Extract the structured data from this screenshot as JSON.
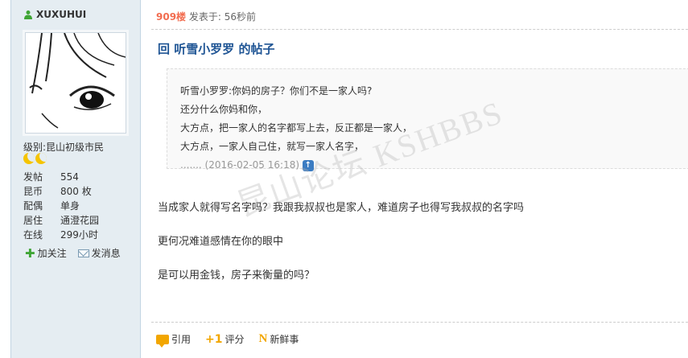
{
  "user": {
    "name": "XUXUHUI",
    "level_label": "级别:",
    "level_value": "昆山初级市民",
    "stats": [
      {
        "label": "发帖",
        "value": "554"
      },
      {
        "label": "昆币",
        "value": "800 枚"
      },
      {
        "label": "配偶",
        "value": "单身"
      },
      {
        "label": "居住",
        "value": "通澄花园"
      },
      {
        "label": "在线",
        "value": "299小时"
      }
    ],
    "follow_label": "加关注",
    "message_label": "发消息"
  },
  "post": {
    "floor": "909楼",
    "posted_prefix": "发表于:",
    "posted_time": "56秒前",
    "title": "回 听雪小罗罗 的帖子",
    "quote_lines": [
      "听雪小罗罗:你妈的房子？你们不是一家人吗?",
      "还分什么你妈和你，",
      "大方点，把一家人的名字都写上去，反正都是一家人，",
      "大方点，一家人自己住，就写一家人名字，"
    ],
    "quote_meta": "....... (2016-02-05 16:18)",
    "body": [
      "当成家人就得写名字吗？我跟我叔叔也是家人，难道房子也得写我叔叔的名字吗",
      "更何况难道感情在你的眼中",
      "是可以用金钱，房子来衡量的吗？"
    ],
    "watermark": "昆山论坛 KSHBBS"
  },
  "footer": {
    "quote_label": "引用",
    "rate_label": "评分",
    "news_label": "新鲜事"
  },
  "colors": {
    "sidebar_bg": "#e5edf2",
    "title": "#1e5494",
    "floor": "#f26c4f"
  }
}
